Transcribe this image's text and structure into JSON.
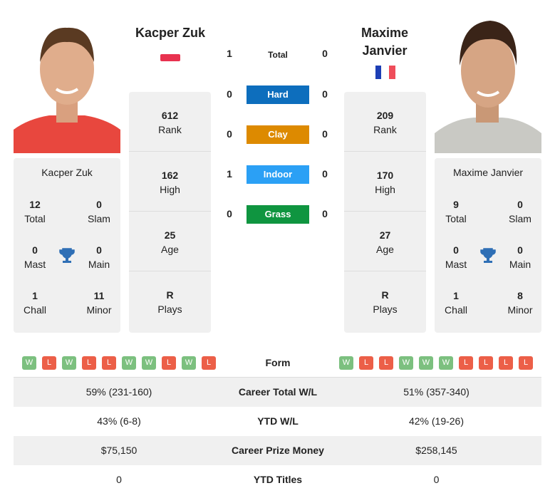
{
  "h2h": {
    "total_label": "Total",
    "left_total": "1",
    "right_total": "0",
    "surfaces": [
      {
        "label": "Hard",
        "left": "0",
        "right": "0",
        "color": "#0d6ebd"
      },
      {
        "label": "Clay",
        "left": "0",
        "right": "0",
        "color": "#dd8a00"
      },
      {
        "label": "Indoor",
        "left": "1",
        "right": "0",
        "color": "#2ba0f5"
      },
      {
        "label": "Grass",
        "left": "0",
        "right": "0",
        "color": "#0f9540"
      }
    ]
  },
  "p1": {
    "name": "Kacper Zuk",
    "flag": "Poland",
    "rank": "612",
    "rank_label": "Rank",
    "high": "162",
    "high_label": "High",
    "age": "25",
    "age_label": "Age",
    "plays": "R",
    "plays_label": "Plays",
    "total": "12",
    "total_label": "Total",
    "slam": "0",
    "slam_label": "Slam",
    "mast": "0",
    "mast_label": "Mast",
    "main": "0",
    "main_label": "Main",
    "chall": "1",
    "chall_label": "Chall",
    "minor": "11",
    "minor_label": "Minor",
    "form": [
      "W",
      "L",
      "W",
      "L",
      "L",
      "W",
      "W",
      "L",
      "W",
      "L"
    ]
  },
  "p2": {
    "name_line1": "Maxime",
    "name_line2": "Janvier",
    "name": "Maxime Janvier",
    "flag": "France",
    "rank": "209",
    "rank_label": "Rank",
    "high": "170",
    "high_label": "High",
    "age": "27",
    "age_label": "Age",
    "plays": "R",
    "plays_label": "Plays",
    "total": "9",
    "total_label": "Total",
    "slam": "0",
    "slam_label": "Slam",
    "mast": "0",
    "mast_label": "Mast",
    "main": "0",
    "main_label": "Main",
    "chall": "1",
    "chall_label": "Chall",
    "minor": "8",
    "minor_label": "Minor",
    "form": [
      "W",
      "L",
      "L",
      "W",
      "W",
      "W",
      "L",
      "L",
      "L",
      "L"
    ]
  },
  "table": {
    "form_label": "Form",
    "rows": [
      {
        "label": "Career Total W/L",
        "left": "59% (231-160)",
        "right": "51% (357-340)"
      },
      {
        "label": "YTD W/L",
        "left": "43% (6-8)",
        "right": "42% (19-26)"
      },
      {
        "label": "Career Prize Money",
        "left": "$75,150",
        "right": "$258,145"
      },
      {
        "label": "YTD Titles",
        "left": "0",
        "right": "0"
      }
    ]
  },
  "colors": {
    "win": "#7cc07f",
    "loss": "#ec5f48",
    "card": "#f0f0f0",
    "trophy": "#2f6fb5"
  }
}
